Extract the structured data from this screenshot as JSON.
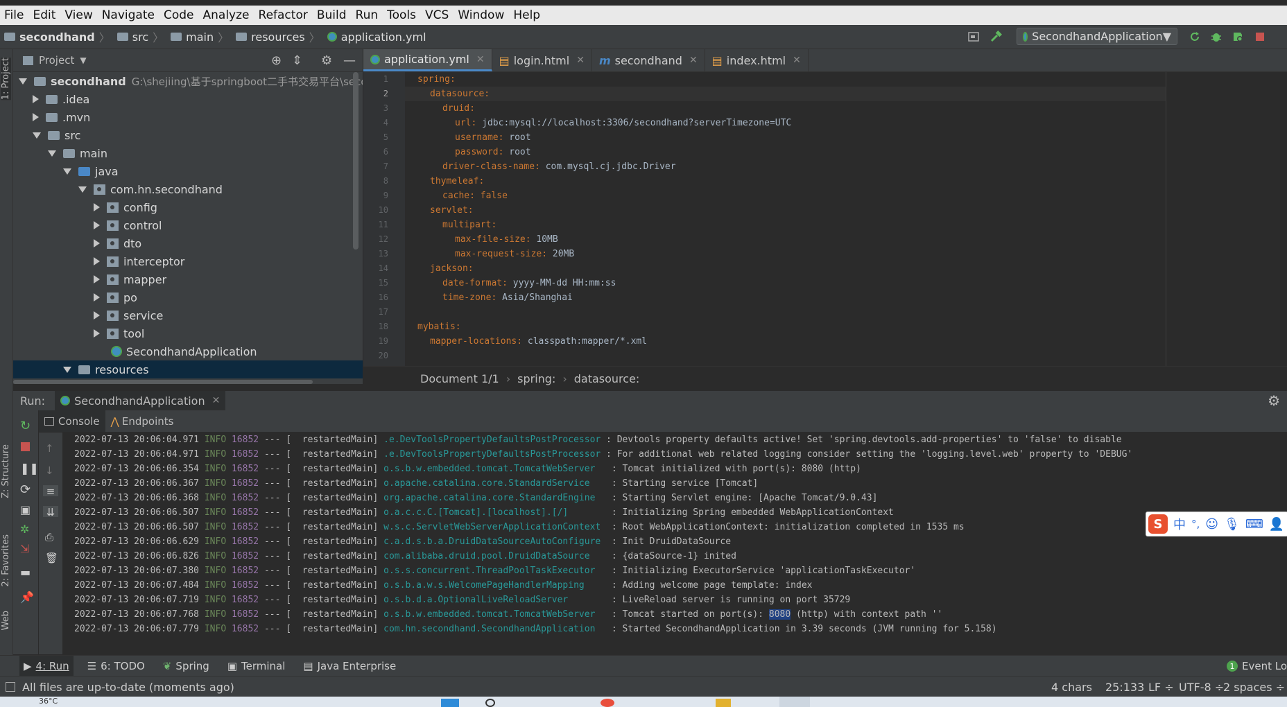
{
  "menu": [
    "File",
    "Edit",
    "View",
    "Navigate",
    "Code",
    "Analyze",
    "Refactor",
    "Build",
    "Run",
    "Tools",
    "VCS",
    "Window",
    "Help"
  ],
  "breadcrumb": [
    "secondhand",
    "src",
    "main",
    "resources",
    "application.yml"
  ],
  "run_config": "SecondhandApplication",
  "left_strip": {
    "project": "1: Project",
    "structure": "Z: Structure",
    "favorites": "2: Favorites",
    "web": "Web"
  },
  "project": {
    "header": "Project",
    "root_name": "secondhand",
    "root_path": "G:\\shejiing\\基于springboot二手书交易平台\\seconc",
    "items": [
      ".idea",
      ".mvn",
      "src",
      "main",
      "java",
      "com.hn.secondhand",
      "config",
      "control",
      "dto",
      "interceptor",
      "mapper",
      "po",
      "service",
      "tool",
      "SecondhandApplication",
      "resources"
    ]
  },
  "editor_tabs": [
    "application.yml",
    "login.html",
    "secondhand",
    "index.html"
  ],
  "code": {
    "line_numbers": [
      "1",
      "2",
      "3",
      "4",
      "5",
      "6",
      "7",
      "8",
      "9",
      "10",
      "11",
      "12",
      "13",
      "14",
      "15",
      "16",
      "17",
      "18",
      "19",
      "20"
    ],
    "lines": [
      {
        "key": "spring:",
        "val": ""
      },
      {
        "key": "datasource:",
        "val": ""
      },
      {
        "key": "druid:",
        "val": ""
      },
      {
        "key": "url:",
        "val": " jdbc:mysql://localhost:3306/secondhand?serverTimezone=UTC"
      },
      {
        "key": "username:",
        "val": " root"
      },
      {
        "key": "password:",
        "val": " root"
      },
      {
        "key": "driver-class-name:",
        "val": " com.mysql.cj.jdbc.Driver"
      },
      {
        "key": "thymeleaf:",
        "val": ""
      },
      {
        "key": "cache:",
        "val": " false"
      },
      {
        "key": "servlet:",
        "val": ""
      },
      {
        "key": "multipart:",
        "val": ""
      },
      {
        "key": "max-file-size:",
        "val": " 10MB"
      },
      {
        "key": "max-request-size:",
        "val": " 20MB"
      },
      {
        "key": "jackson:",
        "val": ""
      },
      {
        "key": "date-format:",
        "val": " yyyy-MM-dd HH:mm:ss"
      },
      {
        "key": "time-zone:",
        "val": " Asia/Shanghai"
      },
      {
        "key": "",
        "val": ""
      },
      {
        "key": "mybatis:",
        "val": ""
      },
      {
        "key": "mapper-locations:",
        "val": " classpath:mapper/*.xml"
      },
      {
        "key": "",
        "val": ""
      }
    ]
  },
  "editor_crumbs": [
    "Document 1/1",
    "spring:",
    "datasource:"
  ],
  "run": {
    "label": "Run:",
    "app": "SecondhandApplication",
    "tabs": [
      "Console",
      "Endpoints"
    ],
    "logs": [
      {
        "ts": "2022-07-13 20:06:04.971",
        "lvl": "INFO",
        "pid": "16852",
        "th": "--- [  restartedMain]",
        "lg": ".e.DevToolsPropertyDefaultsPostProcessor",
        "msg": " : Devtools property defaults active! Set 'spring.devtools.add-properties' to 'false' to disable"
      },
      {
        "ts": "2022-07-13 20:06:04.971",
        "lvl": "INFO",
        "pid": "16852",
        "th": "--- [  restartedMain]",
        "lg": ".e.DevToolsPropertyDefaultsPostProcessor",
        "msg": " : For additional web related logging consider setting the 'logging.level.web' property to 'DEBUG'"
      },
      {
        "ts": "2022-07-13 20:06:06.354",
        "lvl": "INFO",
        "pid": "16852",
        "th": "--- [  restartedMain]",
        "lg": "o.s.b.w.embedded.tomcat.TomcatWebServer  ",
        "msg": " : Tomcat initialized with port(s): 8080 (http)"
      },
      {
        "ts": "2022-07-13 20:06:06.367",
        "lvl": "INFO",
        "pid": "16852",
        "th": "--- [  restartedMain]",
        "lg": "o.apache.catalina.core.StandardService   ",
        "msg": " : Starting service [Tomcat]"
      },
      {
        "ts": "2022-07-13 20:06:06.368",
        "lvl": "INFO",
        "pid": "16852",
        "th": "--- [  restartedMain]",
        "lg": "org.apache.catalina.core.StandardEngine  ",
        "msg": " : Starting Servlet engine: [Apache Tomcat/9.0.43]"
      },
      {
        "ts": "2022-07-13 20:06:06.507",
        "lvl": "INFO",
        "pid": "16852",
        "th": "--- [  restartedMain]",
        "lg": "o.a.c.c.C.[Tomcat].[localhost].[/]       ",
        "msg": " : Initializing Spring embedded WebApplicationContext"
      },
      {
        "ts": "2022-07-13 20:06:06.507",
        "lvl": "INFO",
        "pid": "16852",
        "th": "--- [  restartedMain]",
        "lg": "w.s.c.ServletWebServerApplicationContext ",
        "msg": " : Root WebApplicationContext: initialization completed in 1535 ms"
      },
      {
        "ts": "2022-07-13 20:06:06.629",
        "lvl": "INFO",
        "pid": "16852",
        "th": "--- [  restartedMain]",
        "lg": "c.a.d.s.b.a.DruidDataSourceAutoConfigure ",
        "msg": " : Init DruidDataSource"
      },
      {
        "ts": "2022-07-13 20:06:06.826",
        "lvl": "INFO",
        "pid": "16852",
        "th": "--- [  restartedMain]",
        "lg": "com.alibaba.druid.pool.DruidDataSource   ",
        "msg": " : {dataSource-1} inited"
      },
      {
        "ts": "2022-07-13 20:06:07.380",
        "lvl": "INFO",
        "pid": "16852",
        "th": "--- [  restartedMain]",
        "lg": "o.s.s.concurrent.ThreadPoolTaskExecutor  ",
        "msg": " : Initializing ExecutorService 'applicationTaskExecutor'"
      },
      {
        "ts": "2022-07-13 20:06:07.484",
        "lvl": "INFO",
        "pid": "16852",
        "th": "--- [  restartedMain]",
        "lg": "o.s.b.a.w.s.WelcomePageHandlerMapping    ",
        "msg": " : Adding welcome page template: index"
      },
      {
        "ts": "2022-07-13 20:06:07.719",
        "lvl": "INFO",
        "pid": "16852",
        "th": "--- [  restartedMain]",
        "lg": "o.s.b.d.a.OptionalLiveReloadServer       ",
        "msg": " : LiveReload server is running on port 35729"
      },
      {
        "ts": "2022-07-13 20:06:07.768",
        "lvl": "INFO",
        "pid": "16852",
        "th": "--- [  restartedMain]",
        "lg": "o.s.b.w.embedded.tomcat.TomcatWebServer  ",
        "msg": " : Tomcat started on port(s): ",
        "sel": "8080",
        "tail": " (http) with context path ''"
      },
      {
        "ts": "2022-07-13 20:06:07.779",
        "lvl": "INFO",
        "pid": "16852",
        "th": "--- [  restartedMain]",
        "lg": "com.hn.secondhand.SecondhandApplication  ",
        "msg": " : Started SecondhandApplication in 3.39 seconds (JVM running for 5.158)"
      }
    ]
  },
  "ime": {
    "chinese": "中",
    "punct": "°,"
  },
  "bottom_tabs": [
    "4: Run",
    "6: TODO",
    "Spring",
    "Terminal",
    "Java Enterprise"
  ],
  "event_log": "Event Lo",
  "event_count": "1",
  "status": {
    "message": "All files are up-to-date (moments ago)",
    "chars": "4 chars",
    "pos": "25:133",
    "lf": "LF ÷",
    "enc": "UTF-8 ÷",
    "indent": "2 spaces ÷"
  },
  "taskbar": {
    "weather": "36°C"
  },
  "colors": {
    "accent": "#4a88c7",
    "spring_green": "#4ea34e",
    "stop_red": "#c75450"
  }
}
